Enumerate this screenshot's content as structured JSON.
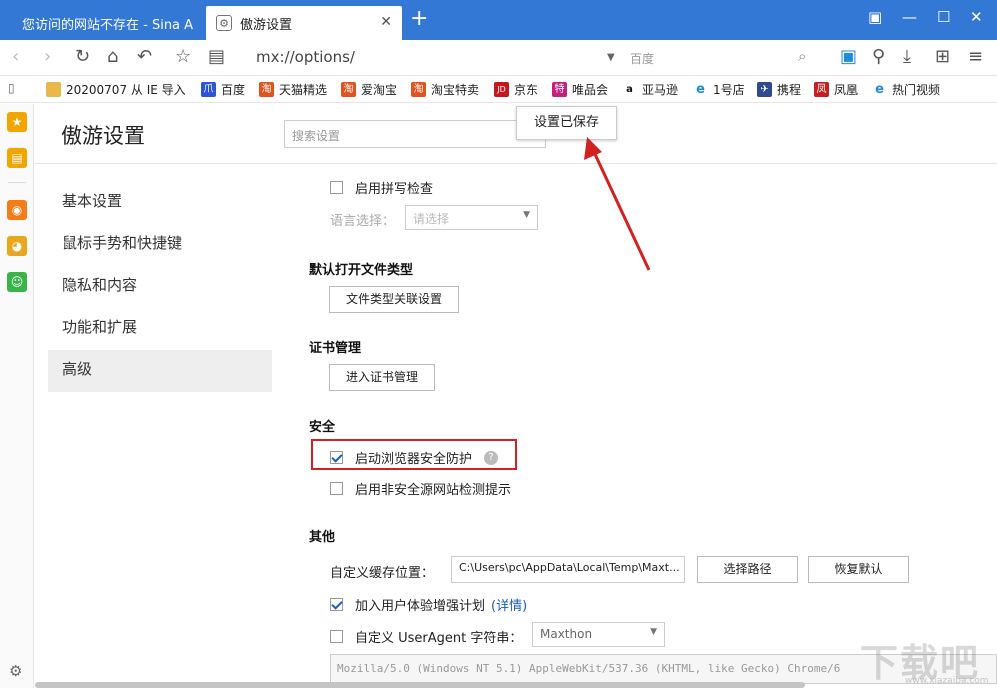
{
  "tabs": [
    {
      "label": "您访问的网站不存在 - Sina A"
    },
    {
      "label": "傲游设置"
    }
  ],
  "toolbar": {
    "address": "mx://options/",
    "search_placeholder": "百度"
  },
  "bookmarks": [
    {
      "label": "20200707 从 IE 导入"
    },
    {
      "label": "百度"
    },
    {
      "label": "天猫精选"
    },
    {
      "label": "爱淘宝"
    },
    {
      "label": "淘宝特卖"
    },
    {
      "label": "京东"
    },
    {
      "label": "唯品会"
    },
    {
      "label": "亚马逊"
    },
    {
      "label": "1号店"
    },
    {
      "label": "携程"
    },
    {
      "label": "凤凰"
    },
    {
      "label": "热门视频"
    }
  ],
  "page": {
    "title": "傲游设置",
    "search_placeholder": "搜索设置",
    "saved_popup": "设置已保存"
  },
  "nav": [
    {
      "label": "基本设置"
    },
    {
      "label": "鼠标手势和快捷键"
    },
    {
      "label": "隐私和内容"
    },
    {
      "label": "功能和扩展"
    },
    {
      "label": "高级"
    }
  ],
  "content": {
    "spellcheck": "启用拼写检查",
    "lang_label": "语言选择：",
    "lang_value": "请选择",
    "filetype_title": "默认打开文件类型",
    "filetype_btn": "文件类型关联设置",
    "cert_title": "证书管理",
    "cert_btn": "进入证书管理",
    "security_title": "安全",
    "security_protect": "启动浏览器安全防护",
    "security_help": "?",
    "unsafe_detect": "启用非安全源网站检测提示",
    "other_title": "其他",
    "cache_label": "自定义缓存位置：",
    "cache_path": "C:\\Users\\pc\\AppData\\Local\\Temp\\Maxt...",
    "choose_path": "选择路径",
    "restore_default": "恢复默认",
    "ux_plan": "加入用户体验增强计划",
    "ux_detail": "(详情)",
    "custom_ua": "自定义 UserAgent 字符串：",
    "ua_select": "Maxthon",
    "ua_string": "Mozilla/5.0 (Windows NT 5.1) AppleWebKit/537.36 (KHTML, like Gecko) Chrome/6"
  },
  "watermark": "下载吧",
  "watermark_url": "www.xiazaiba.com",
  "colors": {
    "accent": "#3478d6",
    "highlight": "#d32121"
  }
}
